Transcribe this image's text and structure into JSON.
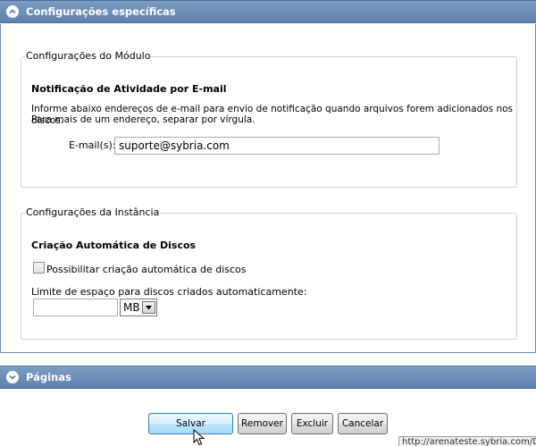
{
  "sections": {
    "specific": {
      "title": "Configurações específicas",
      "expanded": true
    },
    "pages": {
      "title": "Páginas",
      "expanded": false
    }
  },
  "module": {
    "legend": "Configurações do Módulo",
    "heading": "Notificação de Atividade por E-mail",
    "description_line1": "Informe abaixo endereços de e-mail para envio de notificação quando arquivos forem adicionados nos discos.",
    "description_line2": "Para mais de um endereço, separar por vírgula.",
    "email_label": "E-mail(s):",
    "email_value": "suporte@sybria.com"
  },
  "instance": {
    "legend": "Configurações da Instância",
    "heading": "Criação Automática de Discos",
    "checkbox_label": "Possibilitar criação automática de discos",
    "checkbox_checked": false,
    "limit_label": "Limite de espaço para discos criados automaticamente:",
    "limit_value": "",
    "unit_selected": "MB"
  },
  "buttons": {
    "save": "Salvar",
    "remove": "Remover",
    "delete": "Excluir",
    "cancel": "Cancelar"
  },
  "status_url": "http://arenateste.sybria.com/Da",
  "colors": {
    "header": "#6a8bb6",
    "primary_button": "#bee6fd"
  }
}
